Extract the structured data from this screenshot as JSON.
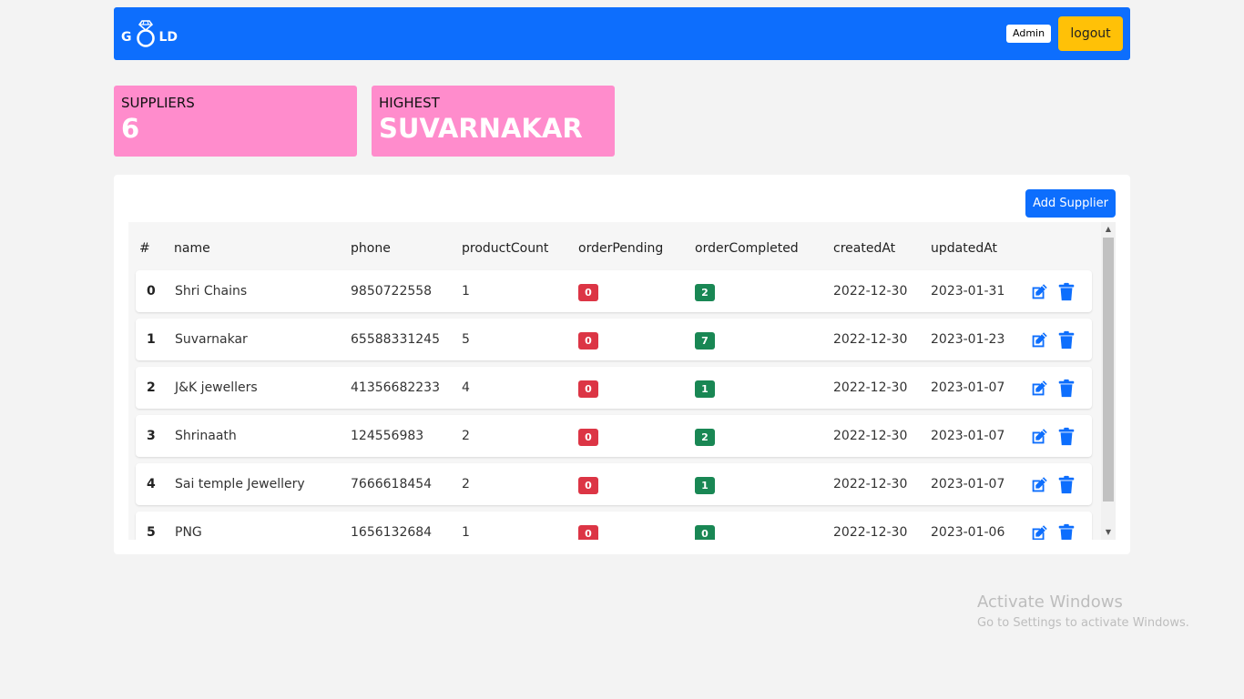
{
  "navbar": {
    "logo_left": "G",
    "logo_right": "LD",
    "admin_label": "Admin",
    "logout_label": "logout",
    "brand_color": "#0d6efd",
    "logout_color": "#ffc107"
  },
  "stats": [
    {
      "label": "SUPPLIERS",
      "value": "6"
    },
    {
      "label": "HIGHEST",
      "value": "SUVARNAKAR"
    }
  ],
  "table": {
    "add_button_label": "Add Supplier",
    "headers": [
      "#",
      "name",
      "phone",
      "productCount",
      "orderPending",
      "orderCompleted",
      "createdAt",
      "updatedAt"
    ],
    "rows": [
      {
        "idx": "0",
        "name": "Shri Chains",
        "phone": "9850722558",
        "productCount": "1",
        "orderPending": "0",
        "orderCompleted": "2",
        "createdAt": "2022-12-30",
        "updatedAt": "2023-01-31"
      },
      {
        "idx": "1",
        "name": "Suvarnakar",
        "phone": "65588331245",
        "productCount": "5",
        "orderPending": "0",
        "orderCompleted": "7",
        "createdAt": "2022-12-30",
        "updatedAt": "2023-01-23"
      },
      {
        "idx": "2",
        "name": "J&K jewellers",
        "phone": "41356682233",
        "productCount": "4",
        "orderPending": "0",
        "orderCompleted": "1",
        "createdAt": "2022-12-30",
        "updatedAt": "2023-01-07"
      },
      {
        "idx": "3",
        "name": "Shrinaath",
        "phone": "124556983",
        "productCount": "2",
        "orderPending": "0",
        "orderCompleted": "2",
        "createdAt": "2022-12-30",
        "updatedAt": "2023-01-07"
      },
      {
        "idx": "4",
        "name": "Sai temple Jewellery",
        "phone": "7666618454",
        "productCount": "2",
        "orderPending": "0",
        "orderCompleted": "1",
        "createdAt": "2022-12-30",
        "updatedAt": "2023-01-07"
      },
      {
        "idx": "5",
        "name": "PNG",
        "phone": "1656132684",
        "productCount": "1",
        "orderPending": "0",
        "orderCompleted": "0",
        "createdAt": "2022-12-30",
        "updatedAt": "2023-01-06"
      }
    ],
    "row_icons": {
      "edit": "edit-icon",
      "delete": "trash-icon"
    },
    "pending_color": "#dc3545",
    "completed_color": "#198754"
  },
  "watermark": {
    "line1": "Activate Windows",
    "line2": "Go to Settings to activate Windows."
  }
}
